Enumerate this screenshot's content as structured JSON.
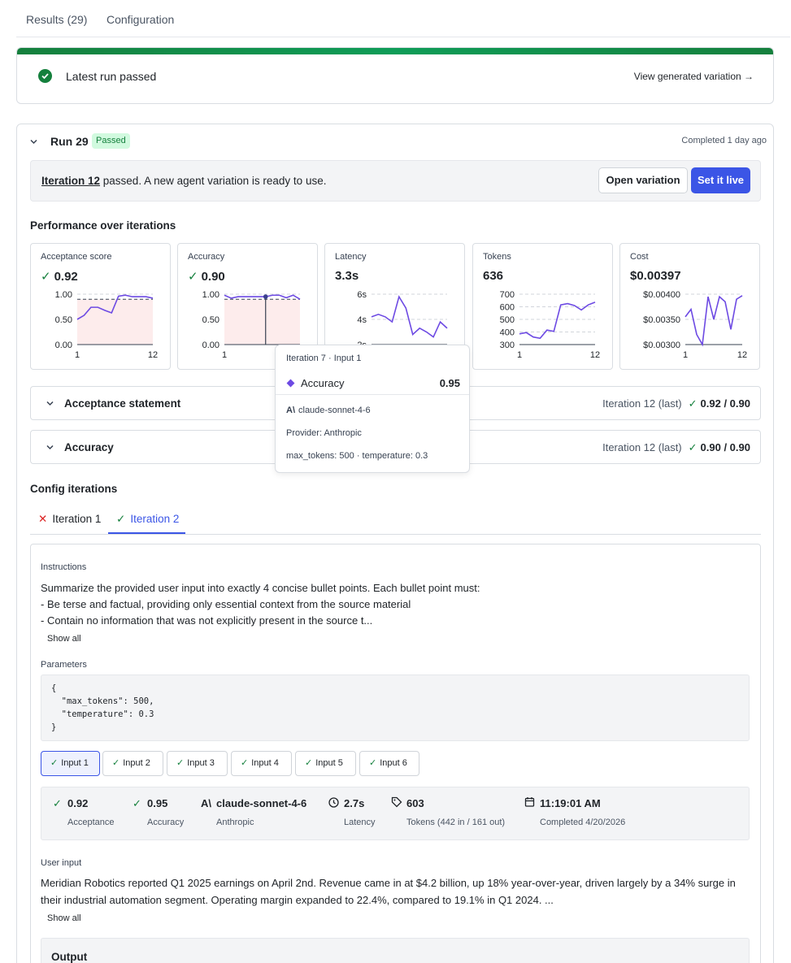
{
  "tabs": [
    "Results (29)",
    "Configuration"
  ],
  "banner": {
    "message": "Latest run passed",
    "link": "View generated variation →"
  },
  "run": {
    "title": "Run 29",
    "status": "Passed",
    "completed": "Completed 1 day ago",
    "notice": {
      "iteration_link": "Iteration 12",
      "rest": " passed. A new agent variation is ready to use."
    },
    "buttons": {
      "open": "Open variation",
      "live": "Set it live"
    }
  },
  "performance": {
    "title": "Performance over iterations",
    "metrics": [
      {
        "label": "Acceptance score",
        "value": "0.92",
        "check": true,
        "yticks": [
          "1.00",
          "0.50",
          "0.00"
        ],
        "xticks": [
          "1",
          "12"
        ],
        "threshold": 0.9,
        "values": [
          0.5,
          0.58,
          0.74,
          0.74,
          0.68,
          0.63,
          0.96,
          0.98,
          0.95,
          0.95,
          0.95,
          0.92
        ],
        "ylim": [
          0,
          1
        ]
      },
      {
        "label": "Accuracy",
        "value": "0.90",
        "check": true,
        "yticks": [
          "1.00",
          "0.50",
          "0.00"
        ],
        "xticks": [
          "1",
          "12"
        ],
        "threshold": 0.9,
        "values": [
          0.98,
          0.92,
          0.95,
          0.95,
          0.95,
          0.95,
          0.95,
          0.98,
          0.98,
          0.93,
          0.98,
          0.9
        ],
        "ylim": [
          0,
          1
        ],
        "hover_index": 7
      },
      {
        "label": "Latency",
        "value": "3.3s",
        "check": false,
        "yticks": [
          "6s",
          "4s",
          "2s"
        ],
        "xticks": [
          "1",
          "12"
        ],
        "values": [
          4.2,
          4.4,
          4.2,
          3.8,
          5.8,
          4.9,
          2.8,
          3.3,
          3.0,
          2.6,
          3.8,
          3.3
        ],
        "ylim": [
          2,
          6
        ]
      },
      {
        "label": "Tokens",
        "value": "636",
        "check": false,
        "yticks": [
          "700",
          "600",
          "500",
          "400",
          "300"
        ],
        "xticks": [
          "1",
          "12"
        ],
        "values": [
          385,
          395,
          360,
          350,
          415,
          405,
          615,
          625,
          610,
          575,
          615,
          636
        ],
        "ylim": [
          300,
          700
        ]
      },
      {
        "label": "Cost",
        "value": "$0.00397",
        "check": false,
        "yticks": [
          "$0.00400",
          "$0.00350",
          "$0.00300"
        ],
        "xticks": [
          "1",
          "12"
        ],
        "values": [
          0.00355,
          0.0037,
          0.0032,
          0.003,
          0.00395,
          0.0035,
          0.00395,
          0.00385,
          0.0033,
          0.0039,
          0.00397
        ],
        "ylim": [
          0.003,
          0.004
        ]
      }
    ]
  },
  "accordions": [
    {
      "title": "Acceptance statement",
      "iteration": "Iteration 12 (last)",
      "score": "0.92 / 0.90"
    },
    {
      "title": "Accuracy",
      "iteration": "Iteration 12 (last)",
      "score": "0.90 / 0.90"
    }
  ],
  "config": {
    "title": "Config iterations",
    "tabs": [
      {
        "label": "Iteration 1",
        "status": "fail"
      },
      {
        "label": "Iteration 2",
        "status": "pass",
        "active": true
      }
    ],
    "instructions_label": "Instructions",
    "instructions": [
      "Summarize the provided user input into exactly 4 concise bullet points. Each bullet point must:",
      "- Be terse and factual, providing only essential context from the source material",
      "- Contain no information that was not explicitly present in the source t..."
    ],
    "show_all": "Show all",
    "parameters_label": "Parameters",
    "parameters_code": "{\n  \"max_tokens\": 500,\n  \"temperature\": 0.3\n}",
    "inputs": [
      "Input 1",
      "Input 2",
      "Input 3",
      "Input 4",
      "Input 5",
      "Input 6"
    ],
    "stats": {
      "acceptance": {
        "value": "0.92",
        "label": "Acceptance"
      },
      "accuracy": {
        "value": "0.95",
        "label": "Accuracy"
      },
      "model": {
        "value": "claude-sonnet-4-6",
        "label": "Anthropic"
      },
      "latency": {
        "value": "2.7s",
        "label": "Latency"
      },
      "tokens": {
        "value": "603",
        "label": "Tokens (442 in / 161 out)"
      },
      "completed": {
        "value": "11:19:01 AM",
        "label": "Completed 4/20/2026"
      }
    },
    "user_input_label": "User input",
    "user_input": "Meridian Robotics reported Q1 2025 earnings on April 2nd. Revenue came in at $4.2 billion, up 18% year-over-year, driven largely by a 34% surge in their industrial automation segment. Operating margin expanded to 22.4%, compared to 19.1% in Q1 2024. ...",
    "output_label": "Output"
  },
  "tooltip": {
    "header": "Iteration 7 · Input 1",
    "metric": "Accuracy",
    "value": "0.95",
    "model": "claude-sonnet-4-6",
    "provider": "Provider: Anthropic",
    "params": "max_tokens: 500 · temperature: 0.3"
  },
  "colors": {
    "accent": "#3b55e6",
    "success": "#15803d",
    "line": "#6d4ae3",
    "fail": "#dc2626"
  }
}
